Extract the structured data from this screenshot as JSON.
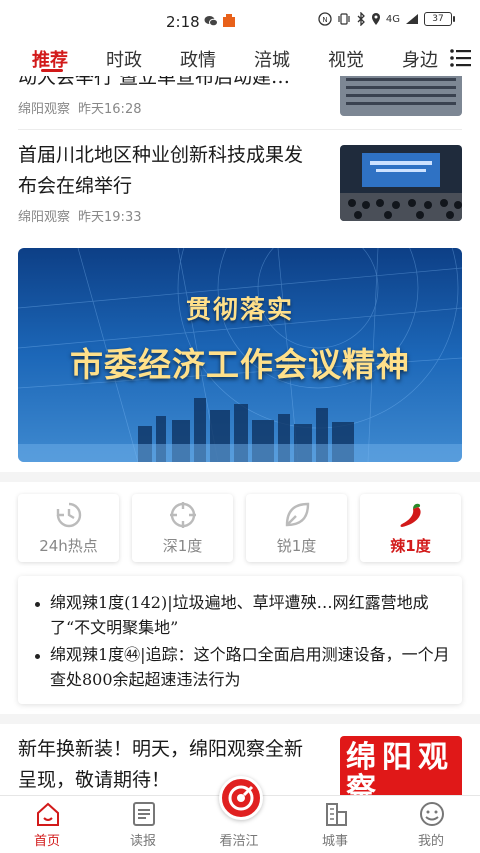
{
  "status_bar": {
    "time": "2:18",
    "battery": "37",
    "network": "4G"
  },
  "nav": {
    "tabs": [
      {
        "label": "推荐",
        "active": true
      },
      {
        "label": "时政"
      },
      {
        "label": "政情"
      },
      {
        "label": "涪城"
      },
      {
        "label": "视觉"
      },
      {
        "label": "身边"
      }
    ]
  },
  "feed": {
    "items": [
      {
        "title": "动大会举行 暨立单宣布启动建…",
        "source": "绵阳观察",
        "time": "昨天16:28"
      },
      {
        "title": "首届川北地区种业创新科技成果发布会在绵举行",
        "source": "绵阳观察",
        "time": "昨天19:33"
      }
    ],
    "banner": {
      "line1": "贯彻落实",
      "line2": "市委经济工作会议精神"
    },
    "depth_cards": [
      {
        "label": "24h热点",
        "icon": "clock-icon"
      },
      {
        "label": "深1度",
        "icon": "crosshair-icon"
      },
      {
        "label": "锐1度",
        "icon": "leaf-icon"
      },
      {
        "label": "辣1度",
        "icon": "chili-icon",
        "active": true
      }
    ],
    "hot_list": [
      "绵观辣1度(142)|垃圾遍地、草坪遭殃…网红露营地成了“不文明聚集地”",
      "绵观辣1度㊹|追踪：这个路口全面启用测速设备，一个月查处800余起超速违法行为"
    ],
    "last_item": {
      "title": "新年换新装！明天，绵阳观察全新呈现，敬请期待！",
      "thumb_text": "绵阳观察"
    }
  },
  "bottom_nav": {
    "items": [
      {
        "label": "首页",
        "icon": "home-icon",
        "active": true
      },
      {
        "label": "读报",
        "icon": "newspaper-icon"
      },
      {
        "label": "看涪江",
        "icon": "watch-center-icon"
      },
      {
        "label": "城事",
        "icon": "city-icon"
      },
      {
        "label": "我的",
        "icon": "profile-icon"
      }
    ]
  },
  "colors": {
    "accent": "#d21a1a",
    "banner_blue": "#1c67b8",
    "text_gold": "#ffe08a"
  }
}
